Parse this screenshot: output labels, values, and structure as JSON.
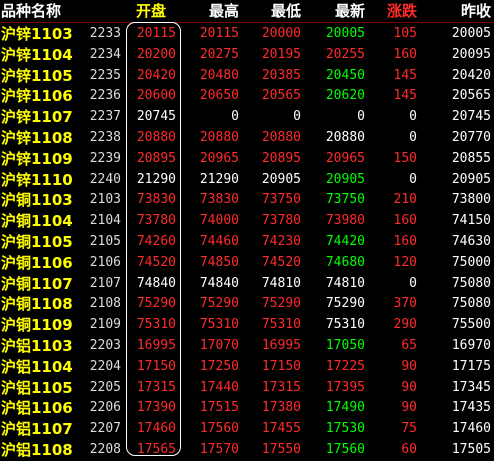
{
  "colors": {
    "up": "#ff2a2a",
    "down": "#00ff00",
    "flat": "#ffffff",
    "name": "#ffff00",
    "code": "#dcdcdc",
    "prev": "#ffffff"
  },
  "headers": [
    {
      "key": "name",
      "label": "品种名称",
      "color": "#ffffff"
    },
    {
      "key": "code",
      "label": "",
      "color": "#ffffff"
    },
    {
      "key": "open",
      "label": "开盘",
      "color": "#ffff00"
    },
    {
      "key": "high",
      "label": "最高",
      "color": "#ffffff"
    },
    {
      "key": "low",
      "label": "最低",
      "color": "#ffffff"
    },
    {
      "key": "last",
      "label": "最新",
      "color": "#ffffff"
    },
    {
      "key": "chg",
      "label": "涨跌",
      "color": "#ff2a2a"
    },
    {
      "key": "prev",
      "label": "昨收",
      "color": "#ffffff"
    }
  ],
  "rows": [
    {
      "name": "沪锌1103",
      "code": "2233",
      "open": "20115",
      "open_c": "up",
      "high": "20115",
      "high_c": "up",
      "low": "20000",
      "low_c": "up",
      "last": "20005",
      "last_c": "down",
      "chg": "105",
      "chg_c": "up",
      "prev": "20005"
    },
    {
      "name": "沪锌1104",
      "code": "2234",
      "open": "20200",
      "open_c": "up",
      "high": "20275",
      "high_c": "up",
      "low": "20195",
      "low_c": "up",
      "last": "20255",
      "last_c": "up",
      "chg": "160",
      "chg_c": "up",
      "prev": "20095"
    },
    {
      "name": "沪锌1105",
      "code": "2235",
      "open": "20420",
      "open_c": "up",
      "high": "20480",
      "high_c": "up",
      "low": "20385",
      "low_c": "up",
      "last": "20450",
      "last_c": "down",
      "chg": "145",
      "chg_c": "up",
      "prev": "20420"
    },
    {
      "name": "沪锌1106",
      "code": "2236",
      "open": "20600",
      "open_c": "up",
      "high": "20650",
      "high_c": "up",
      "low": "20565",
      "low_c": "up",
      "last": "20620",
      "last_c": "down",
      "chg": "145",
      "chg_c": "up",
      "prev": "20565"
    },
    {
      "name": "沪锌1107",
      "code": "2237",
      "open": "20745",
      "open_c": "flat",
      "high": "0",
      "high_c": "flat",
      "low": "0",
      "low_c": "flat",
      "last": "0",
      "last_c": "flat",
      "chg": "0",
      "chg_c": "flat",
      "prev": "20745"
    },
    {
      "name": "沪锌1108",
      "code": "2238",
      "open": "20880",
      "open_c": "up",
      "high": "20880",
      "high_c": "up",
      "low": "20880",
      "low_c": "up",
      "last": "20880",
      "last_c": "flat",
      "chg": "0",
      "chg_c": "flat",
      "prev": "20770"
    },
    {
      "name": "沪锌1109",
      "code": "2239",
      "open": "20895",
      "open_c": "up",
      "high": "20965",
      "high_c": "up",
      "low": "20895",
      "low_c": "up",
      "last": "20965",
      "last_c": "up",
      "chg": "150",
      "chg_c": "up",
      "prev": "20855"
    },
    {
      "name": "沪锌1110",
      "code": "2240",
      "open": "21290",
      "open_c": "flat",
      "high": "21290",
      "high_c": "flat",
      "low": "20905",
      "low_c": "flat",
      "last": "20905",
      "last_c": "down",
      "chg": "0",
      "chg_c": "flat",
      "prev": "20905"
    },
    {
      "name": "沪铜1103",
      "code": "2103",
      "open": "73830",
      "open_c": "up",
      "high": "73830",
      "high_c": "up",
      "low": "73750",
      "low_c": "up",
      "last": "73750",
      "last_c": "down",
      "chg": "210",
      "chg_c": "up",
      "prev": "73800"
    },
    {
      "name": "沪铜1104",
      "code": "2104",
      "open": "73780",
      "open_c": "up",
      "high": "74000",
      "high_c": "up",
      "low": "73780",
      "low_c": "up",
      "last": "73980",
      "last_c": "up",
      "chg": "160",
      "chg_c": "up",
      "prev": "74150"
    },
    {
      "name": "沪铜1105",
      "code": "2105",
      "open": "74260",
      "open_c": "up",
      "high": "74460",
      "high_c": "up",
      "low": "74230",
      "low_c": "up",
      "last": "74420",
      "last_c": "down",
      "chg": "160",
      "chg_c": "up",
      "prev": "74630"
    },
    {
      "name": "沪铜1106",
      "code": "2106",
      "open": "74520",
      "open_c": "up",
      "high": "74850",
      "high_c": "up",
      "low": "74520",
      "low_c": "up",
      "last": "74680",
      "last_c": "down",
      "chg": "120",
      "chg_c": "up",
      "prev": "75000"
    },
    {
      "name": "沪铜1107",
      "code": "2107",
      "open": "74840",
      "open_c": "flat",
      "high": "74840",
      "high_c": "flat",
      "low": "74810",
      "low_c": "flat",
      "last": "74810",
      "last_c": "flat",
      "chg": "0",
      "chg_c": "flat",
      "prev": "75080"
    },
    {
      "name": "沪铜1108",
      "code": "2108",
      "open": "75290",
      "open_c": "up",
      "high": "75290",
      "high_c": "up",
      "low": "75290",
      "low_c": "up",
      "last": "75290",
      "last_c": "flat",
      "chg": "370",
      "chg_c": "up",
      "prev": "75080"
    },
    {
      "name": "沪铜1109",
      "code": "2109",
      "open": "75310",
      "open_c": "up",
      "high": "75310",
      "high_c": "up",
      "low": "75310",
      "low_c": "up",
      "last": "75310",
      "last_c": "flat",
      "chg": "290",
      "chg_c": "up",
      "prev": "75500"
    },
    {
      "name": "沪铝1103",
      "code": "2203",
      "open": "16995",
      "open_c": "up",
      "high": "17070",
      "high_c": "up",
      "low": "16995",
      "low_c": "up",
      "last": "17050",
      "last_c": "down",
      "chg": "65",
      "chg_c": "up",
      "prev": "16970"
    },
    {
      "name": "沪铝1104",
      "code": "2204",
      "open": "17150",
      "open_c": "up",
      "high": "17250",
      "high_c": "up",
      "low": "17150",
      "low_c": "up",
      "last": "17225",
      "last_c": "up",
      "chg": "90",
      "chg_c": "up",
      "prev": "17175"
    },
    {
      "name": "沪铝1105",
      "code": "2205",
      "open": "17315",
      "open_c": "up",
      "high": "17440",
      "high_c": "up",
      "low": "17315",
      "low_c": "up",
      "last": "17395",
      "last_c": "up",
      "chg": "90",
      "chg_c": "up",
      "prev": "17345"
    },
    {
      "name": "沪铝1106",
      "code": "2206",
      "open": "17390",
      "open_c": "up",
      "high": "17515",
      "high_c": "up",
      "low": "17380",
      "low_c": "up",
      "last": "17490",
      "last_c": "down",
      "chg": "90",
      "chg_c": "up",
      "prev": "17435"
    },
    {
      "name": "沪铝1107",
      "code": "2207",
      "open": "17460",
      "open_c": "up",
      "high": "17560",
      "high_c": "up",
      "low": "17455",
      "low_c": "up",
      "last": "17530",
      "last_c": "down",
      "chg": "75",
      "chg_c": "up",
      "prev": "17460"
    },
    {
      "name": "沪铝1108",
      "code": "2208",
      "open": "17565",
      "open_c": "up",
      "high": "17570",
      "high_c": "up",
      "low": "17550",
      "low_c": "up",
      "last": "17560",
      "last_c": "down",
      "chg": "60",
      "chg_c": "up",
      "prev": "17505"
    }
  ]
}
